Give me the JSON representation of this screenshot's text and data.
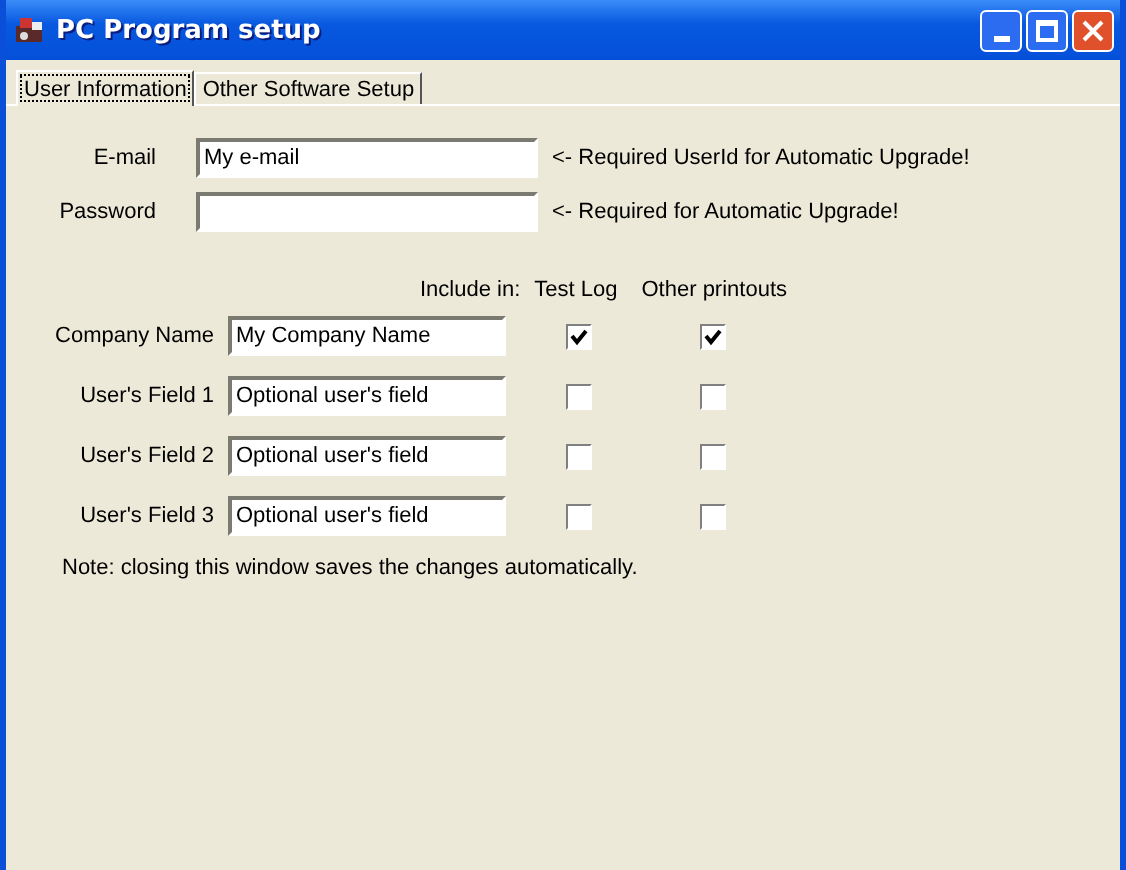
{
  "window": {
    "title": "PC Program setup"
  },
  "tabs": [
    {
      "label": "User Information",
      "selected": true
    },
    {
      "label": "Other Software Setup",
      "selected": false
    }
  ],
  "account": [
    {
      "label": "E-mail",
      "value": "My e-mail",
      "hint": "<- Required UserId for Automatic Upgrade!"
    },
    {
      "label": "Password",
      "hint": "<- Required for Automatic Upgrade!"
    }
  ],
  "include_header": {
    "label": "Include in:",
    "columns": [
      "Test Log",
      "Other printouts"
    ]
  },
  "fields": [
    {
      "label": "Company Name",
      "value": "My Company Name",
      "test_log": true,
      "other_printouts": true
    },
    {
      "label": "User's Field 1",
      "value": "Optional user's field",
      "test_log": false,
      "other_printouts": false
    },
    {
      "label": "User's Field 2",
      "value": "Optional user's field",
      "test_log": false,
      "other_printouts": false
    },
    {
      "label": "User's Field 3",
      "value": "Optional user's field",
      "test_log": false,
      "other_printouts": false
    }
  ],
  "note": "Note: closing this window saves the changes automatically."
}
